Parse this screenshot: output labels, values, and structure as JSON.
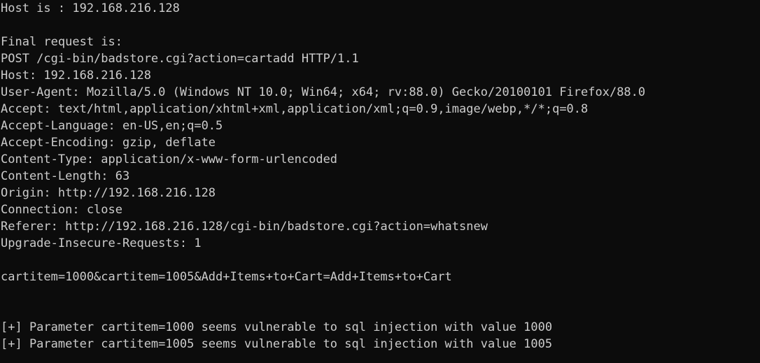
{
  "terminal": {
    "lines": [
      "Host is : 192.168.216.128",
      "",
      "Final request is:",
      "POST /cgi-bin/badstore.cgi?action=cartadd HTTP/1.1",
      "Host: 192.168.216.128",
      "User-Agent: Mozilla/5.0 (Windows NT 10.0; Win64; x64; rv:88.0) Gecko/20100101 Firefox/88.0",
      "Accept: text/html,application/xhtml+xml,application/xml;q=0.9,image/webp,*/*;q=0.8",
      "Accept-Language: en-US,en;q=0.5",
      "Accept-Encoding: gzip, deflate",
      "Content-Type: application/x-www-form-urlencoded",
      "Content-Length: 63",
      "Origin: http://192.168.216.128",
      "Connection: close",
      "Referer: http://192.168.216.128/cgi-bin/badstore.cgi?action=whatsnew",
      "Upgrade-Insecure-Requests: 1",
      "",
      "cartitem=1000&cartitem=1005&Add+Items+to+Cart=Add+Items+to+Cart",
      "",
      "",
      "[+] Parameter cartitem=1000 seems vulnerable to sql injection with value 1000",
      "[+] Parameter cartitem=1005 seems vulnerable to sql injection with value 1005"
    ]
  }
}
